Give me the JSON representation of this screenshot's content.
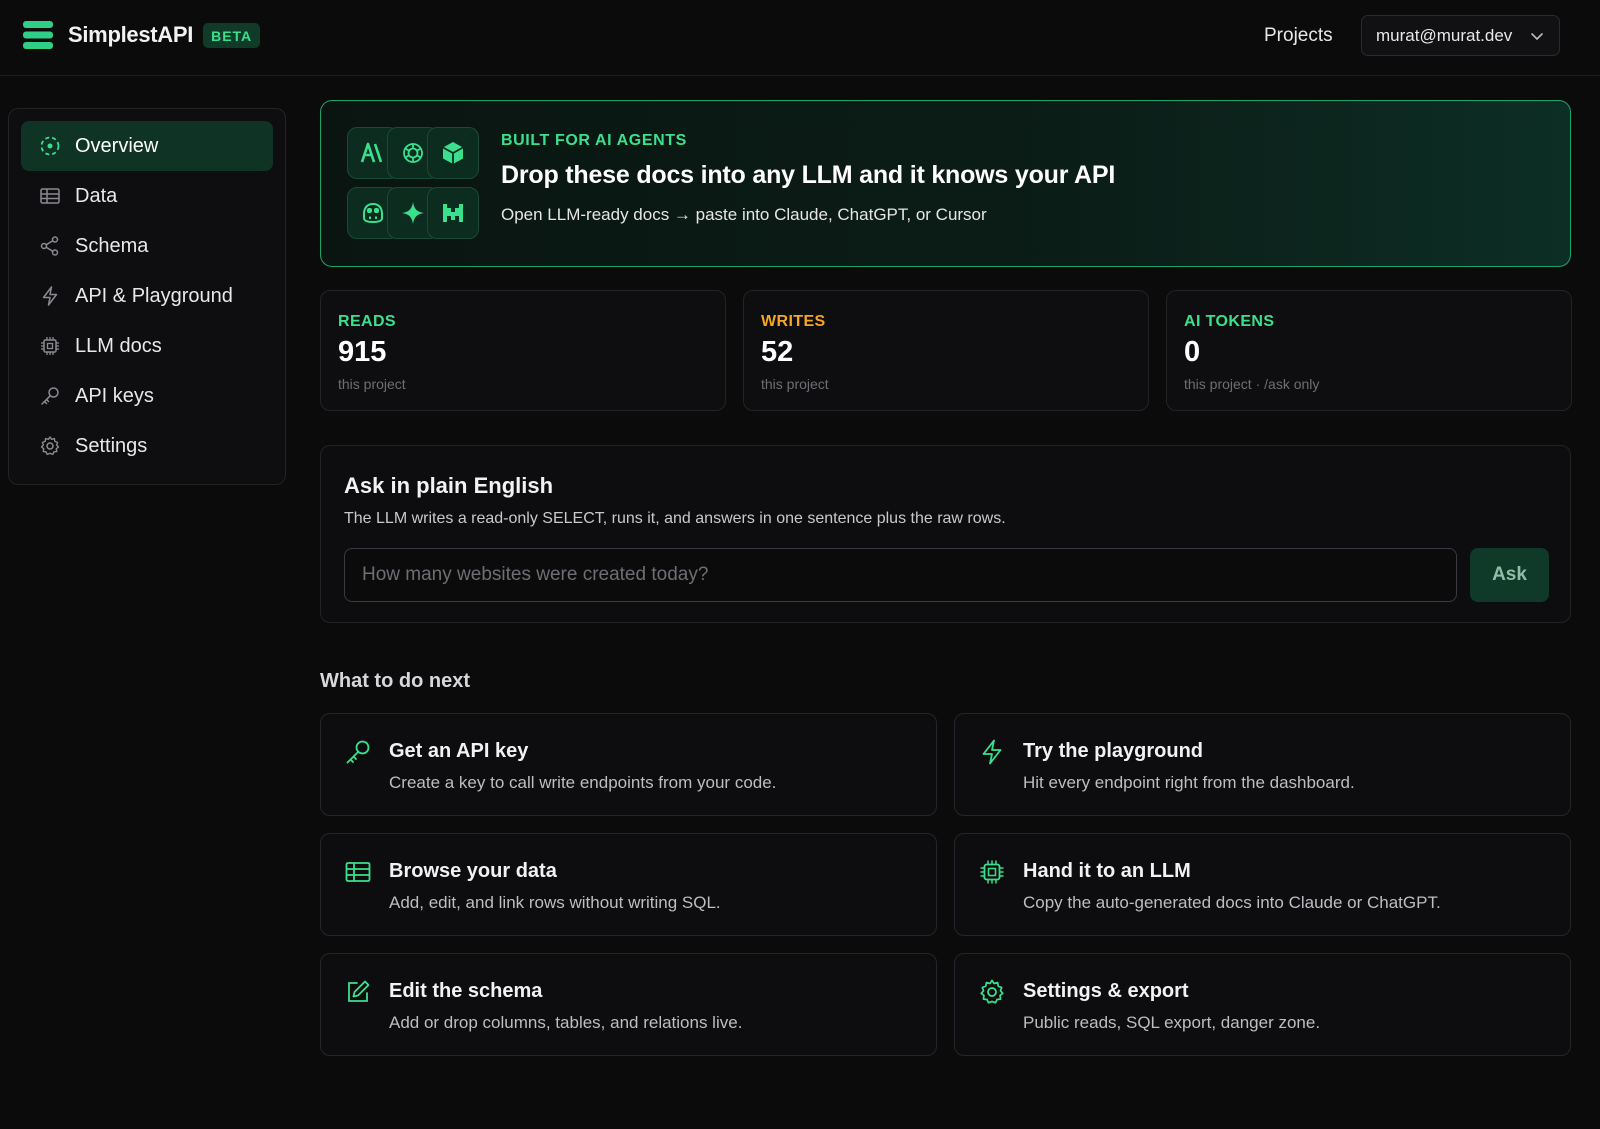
{
  "app": {
    "name": "SimplestAPI",
    "badge": "BETA"
  },
  "header": {
    "projects_label": "Projects",
    "user_email": "murat@murat.dev"
  },
  "sidebar": {
    "items": [
      {
        "label": "Overview",
        "icon": "overview-icon",
        "active": true
      },
      {
        "label": "Data",
        "icon": "table-icon"
      },
      {
        "label": "Schema",
        "icon": "share-icon"
      },
      {
        "label": "API & Playground",
        "icon": "bolt-icon"
      },
      {
        "label": "LLM docs",
        "icon": "chip-icon"
      },
      {
        "label": "API keys",
        "icon": "key-icon"
      },
      {
        "label": "Settings",
        "icon": "gear-icon"
      }
    ]
  },
  "hero": {
    "kicker": "BUILT FOR AI AGENTS",
    "title": "Drop these docs into any LLM and it knows your API",
    "subtitle": "Open LLM-ready docs → paste into Claude, ChatGPT, or Cursor",
    "logos": [
      "anthropic-icon",
      "openai-icon",
      "cursor-icon",
      "copilot-icon",
      "gemini-icon",
      "mistral-icon"
    ]
  },
  "stats": [
    {
      "label": "READS",
      "value": "915",
      "sub": "this project",
      "color": "#3be08e"
    },
    {
      "label": "WRITES",
      "value": "52",
      "sub": "this project",
      "color": "#f5a623"
    },
    {
      "label": "AI TOKENS",
      "value": "0",
      "sub": "this project · /ask only",
      "color": "#3be08e"
    }
  ],
  "ask": {
    "title": "Ask in plain English",
    "description": "The LLM writes a read-only SELECT, runs it, and answers in one sentence plus the raw rows.",
    "placeholder": "How many websites were created today?",
    "button": "Ask"
  },
  "next": {
    "title": "What to do next",
    "cards": [
      {
        "title": "Get an API key",
        "desc": "Create a key to call write endpoints from your code.",
        "icon": "key-icon"
      },
      {
        "title": "Try the playground",
        "desc": "Hit every endpoint right from the dashboard.",
        "icon": "bolt-icon"
      },
      {
        "title": "Browse your data",
        "desc": "Add, edit, and link rows without writing SQL.",
        "icon": "table-icon"
      },
      {
        "title": "Hand it to an LLM",
        "desc": "Copy the auto-generated docs into Claude or ChatGPT.",
        "icon": "chip-icon"
      },
      {
        "title": "Edit the schema",
        "desc": "Add or drop columns, tables, and relations live.",
        "icon": "pencil-icon"
      },
      {
        "title": "Settings & export",
        "desc": "Public reads, SQL export, danger zone.",
        "icon": "gear-icon"
      }
    ]
  },
  "colors": {
    "accent": "#3be08e",
    "warn": "#f5a623",
    "bg": "#0b0b0c"
  }
}
